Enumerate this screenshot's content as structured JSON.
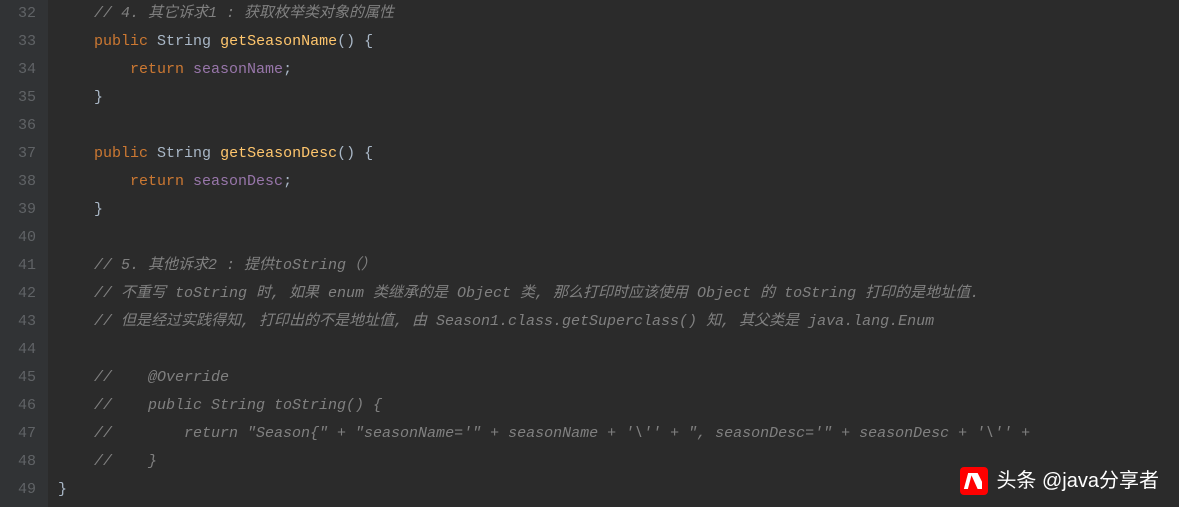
{
  "gutter": {
    "start": 32,
    "end": 49
  },
  "code": {
    "l32": "    // 4. 其它诉求1 : 获取枚举类对象的属性",
    "l33_kw1": "public",
    "l33_type": "String",
    "l33_method": "getSeasonName",
    "l33_tail": "() {",
    "l34_kw": "return",
    "l34_field": "seasonName",
    "l34_semi": ";",
    "l35": "    }",
    "l36": "",
    "l37_kw1": "public",
    "l37_type": "String",
    "l37_method": "getSeasonDesc",
    "l37_tail": "() {",
    "l38_kw": "return",
    "l38_field": "seasonDesc",
    "l38_semi": ";",
    "l39": "    }",
    "l40": "",
    "l41": "    // 5. 其他诉求2 : 提供toString（）",
    "l42": "    // 不重写 toString 时, 如果 enum 类继承的是 Object 类, 那么打印时应该使用 Object 的 toString 打印的是地址值.",
    "l43": "    // 但是经过实践得知, 打印出的不是地址值, 由 Season1.class.getSuperclass() 知, 其父类是 java.lang.Enum",
    "l44": "",
    "l45": "    //    @Override",
    "l46": "    //    public String toString() {",
    "l47": "    //        return \"Season{\" + \"seasonName='\" + seasonName + '\\'' + \", seasonDesc='\" + seasonDesc + '\\'' + ",
    "l48": "    //    }",
    "l49": "}"
  },
  "watermark": {
    "text": "头条 @java分享者"
  }
}
